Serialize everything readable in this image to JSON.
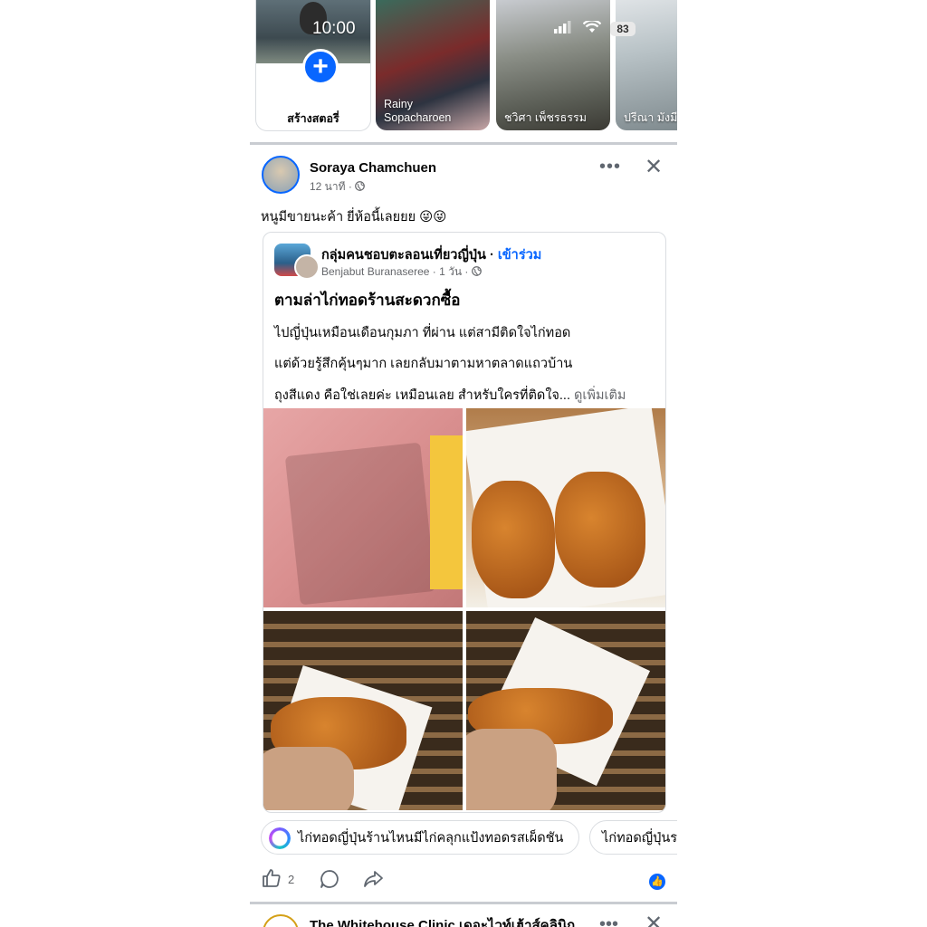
{
  "status_bar": {
    "time": "10:00",
    "battery": "83"
  },
  "stories": {
    "create_label": "สร้างสตอรี่",
    "items": [
      {
        "name": "Rainy\nSopacharoen"
      },
      {
        "name": "ชวิศา เพ็ชรธรรม"
      },
      {
        "name": "ปรีณา มังมี"
      }
    ]
  },
  "post": {
    "author": "Soraya Chamchuen",
    "time": "12 นาที · ",
    "caption": "หนูมีขายนะค้า ยี่ห้อนี้เลยยย 😜😜",
    "shared": {
      "group_name": "กลุ่มคนชอบตะลอนเที่ยวญี่ปุ่น · ",
      "join_label": "เข้าร่วม",
      "author_meta": "Benjabut Buranaseree · 1 วัน · ",
      "title": "ตามล่าไก่ทอดร้านสะดวกซื้อ",
      "lines": [
        "ไปญี่ปุ่นเหมือนเดือนกุมภา ที่ผ่าน แต่สามีติดใจไก่ทอด",
        "แต่ด้วยรู้สึกคุ้นๆมาก เลยกลับมาตามหาตลาดแถวบ้าน",
        "ถุงสีแดง คือใช่เลยค่ะ เหมือนเลย สำหรับใครที่ติดใจ... "
      ],
      "see_more": "ดูเพิ่มเติม"
    },
    "chips": [
      "ไก่ทอดญี่ปุ่นร้านไหนมีไก่คลุกแป้งทอดรสเผ็ดชัน",
      "ไก่ทอดญี่ปุ่นร"
    ],
    "like_count": "2"
  },
  "next_post": {
    "author": "The Whitehouse Clinic  เดอะไวท์เฮ้าส์คลินิก"
  },
  "icons": {
    "like": "thumbs-up-icon",
    "comment": "comment-icon",
    "share": "share-icon",
    "globe": "globe-icon",
    "more": "more-icon",
    "close": "close-icon"
  },
  "colors": {
    "accent": "#0866ff",
    "secondary_text": "#65676b"
  }
}
